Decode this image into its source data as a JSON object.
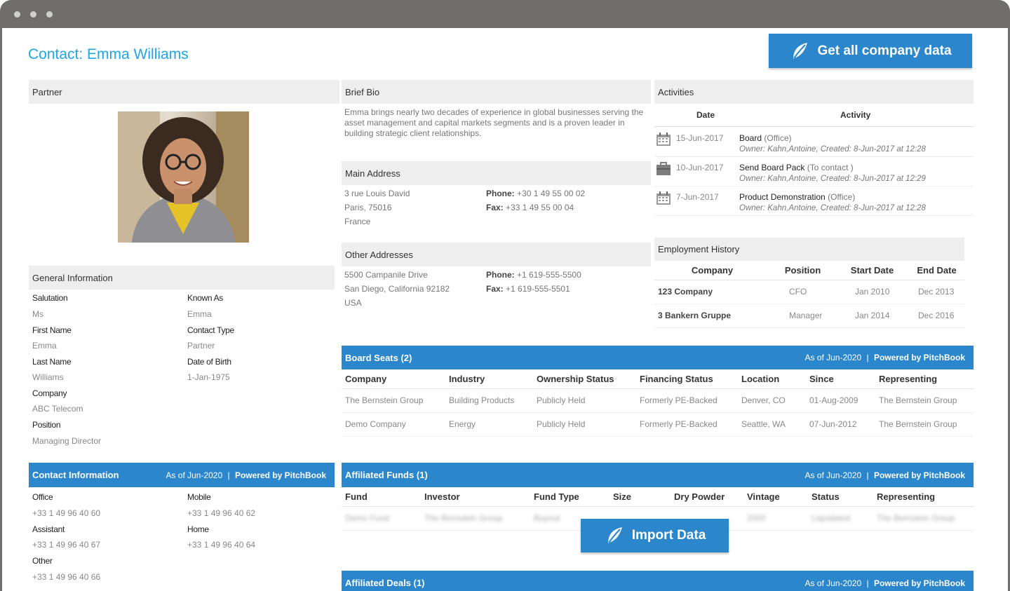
{
  "page_title": "Contact: Emma Williams",
  "buttons": {
    "get_all": "Get all company data",
    "import": "Import Data"
  },
  "partner": {
    "header": "Partner"
  },
  "general": {
    "header": "General Information",
    "left": [
      {
        "label": "Salutation",
        "value": "Ms"
      },
      {
        "label": "First Name",
        "value": "Emma"
      },
      {
        "label": "Last Name",
        "value": "Williams"
      },
      {
        "label": "Company",
        "value": "ABC Telecom"
      },
      {
        "label": "Position",
        "value": "Managing Director"
      }
    ],
    "right": [
      {
        "label": "Known As",
        "value": "Emma"
      },
      {
        "label": "Contact Type",
        "value": "Partner"
      },
      {
        "label": "Date of Birth",
        "value": "1-Jan-1975"
      }
    ]
  },
  "contact_info": {
    "header": "Contact Information",
    "as_of": "As of Jun-2020",
    "sep": "|",
    "powered": "Powered by PitchBook",
    "left": [
      {
        "label": "Office",
        "value": "+33 1 49 96 40 60"
      },
      {
        "label": "Assistant",
        "value": "+33 1 49 96 40 67"
      },
      {
        "label": "Other",
        "value": "+33 1 49 96 40 66"
      }
    ],
    "right": [
      {
        "label": "Mobile",
        "value": "+33 1 49 96 40 62"
      },
      {
        "label": "Home",
        "value": "+33 1 49 96 40 64"
      }
    ]
  },
  "bio": {
    "header": "Brief Bio",
    "text": "Emma brings nearly two decades of experience in global businesses serving the asset management and capital markets segments and is a proven leader in building strategic client relationships."
  },
  "main_address": {
    "header": "Main Address",
    "lines": [
      "3 rue Louis David",
      "Paris, 75016",
      "France"
    ],
    "phone_label": "Phone:",
    "phone": "+30 1 49 55 00 02",
    "fax_label": "Fax:",
    "fax": "+33 1 49 55 00 04"
  },
  "other_addresses": {
    "header": "Other Addresses",
    "lines": [
      "5500 Campanile Drive",
      "San Diego, California 92182",
      "USA"
    ],
    "phone_label": "Phone:",
    "phone": "+1 619-555-5500",
    "fax_label": "Fax:",
    "fax": "+1 619-555-5501"
  },
  "activities": {
    "header": "Activities",
    "col_date": "Date",
    "col_activity": "Activity",
    "rows": [
      {
        "icon": "calendar-icon",
        "date": "15-Jun-2017",
        "title": "Board",
        "type": "(Office)",
        "owner": "Owner: Kahn,Antoine, Created: 8-Jun-2017 at 12:28"
      },
      {
        "icon": "briefcase-icon",
        "date": "10-Jun-2017",
        "title": "Send Board Pack",
        "type": "(To contact )",
        "owner": "Owner: Kahn,Antoine, Created: 8-Jun-2017 at 12:29"
      },
      {
        "icon": "calendar-icon",
        "date": "7-Jun-2017",
        "title": "Product Demonstration",
        "type": "(Office)",
        "owner": "Owner: Kahn,Antoine, Created: 8-Jun-2017 at 12:28"
      }
    ]
  },
  "employment": {
    "header": "Employment History",
    "columns": [
      "Company",
      "Position",
      "Start Date",
      "End Date"
    ],
    "rows": [
      [
        "123 Company",
        "CFO",
        "Jan 2010",
        "Dec 2013"
      ],
      [
        "3 Bankern Gruppe",
        "Manager",
        "Jan 2014",
        "Dec 2016"
      ]
    ]
  },
  "board_seats": {
    "header": "Board Seats (2)",
    "as_of": "As of Jun-2020",
    "sep": "|",
    "powered": "Powered by PitchBook",
    "columns": [
      "Company",
      "Industry",
      "Ownership Status",
      "Financing Status",
      "Location",
      "Since",
      "Representing"
    ],
    "rows": [
      [
        "The Bernstein Group",
        "Building Products",
        "Publicly Held",
        "Formerly PE-Backed",
        "Denver, CO",
        "01-Aug-2009",
        "The Bernstein Group"
      ],
      [
        "Demo Company",
        "Energy",
        "Publicly Held",
        "Formerly PE-Backed",
        "Seattle, WA",
        "07-Jun-2012",
        "The Bernstein Group"
      ]
    ]
  },
  "affiliated_funds": {
    "header": "Affiliated Funds (1)",
    "as_of": "As of Jun-2020",
    "sep": "|",
    "powered": "Powered by PitchBook",
    "columns": [
      "Fund",
      "Investor",
      "Fund Type",
      "Size",
      "Dry Powder",
      "Vintage",
      "Status",
      "Representing"
    ],
    "rows": [
      [
        "Demo Fund",
        "The Bernstein Group",
        "Buyout",
        "",
        "",
        "2000",
        "Liquidated",
        "The Bernstein Group"
      ]
    ]
  },
  "affiliated_deals": {
    "header": "Affiliated Deals (1)",
    "as_of": "As of Jun-2020",
    "sep": "|",
    "powered": "Powered by PitchBook"
  }
}
